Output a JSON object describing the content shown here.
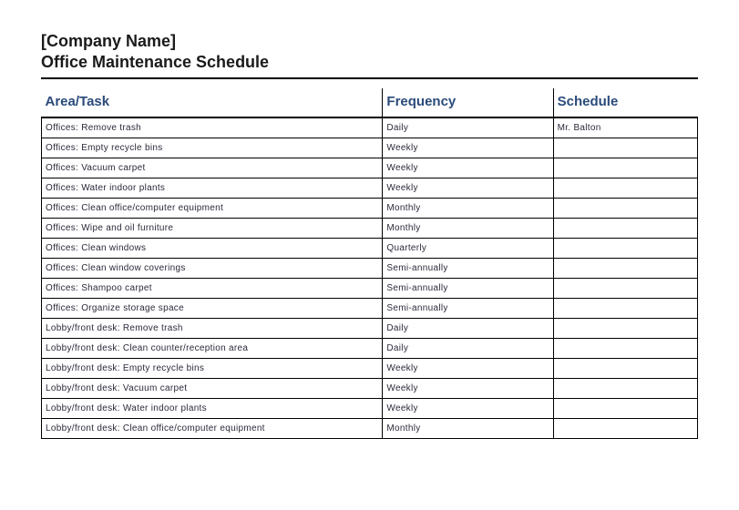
{
  "header": {
    "company_name": "[Company Name]",
    "doc_title": "Office Maintenance Schedule"
  },
  "table": {
    "columns": {
      "area": "Area/Task",
      "frequency": "Frequency",
      "schedule": "Schedule"
    },
    "rows": [
      {
        "area": "Offices: Remove trash",
        "frequency": "Daily",
        "schedule": "Mr. Balton"
      },
      {
        "area": "Offices: Empty recycle bins",
        "frequency": "Weekly",
        "schedule": ""
      },
      {
        "area": "Offices: Vacuum carpet",
        "frequency": "Weekly",
        "schedule": ""
      },
      {
        "area": "Offices: Water indoor plants",
        "frequency": "Weekly",
        "schedule": ""
      },
      {
        "area": "Offices: Clean office/computer equipment",
        "frequency": "Monthly",
        "schedule": ""
      },
      {
        "area": "Offices: Wipe and oil furniture",
        "frequency": "Monthly",
        "schedule": ""
      },
      {
        "area": "Offices: Clean windows",
        "frequency": "Quarterly",
        "schedule": ""
      },
      {
        "area": "Offices: Clean window coverings",
        "frequency": "Semi-annually",
        "schedule": ""
      },
      {
        "area": "Offices: Shampoo carpet",
        "frequency": "Semi-annually",
        "schedule": ""
      },
      {
        "area": "Offices: Organize storage space",
        "frequency": "Semi-annually",
        "schedule": ""
      },
      {
        "area": "Lobby/front desk: Remove trash",
        "frequency": "Daily",
        "schedule": ""
      },
      {
        "area": "Lobby/front desk: Clean counter/reception area",
        "frequency": "Daily",
        "schedule": ""
      },
      {
        "area": "Lobby/front desk: Empty recycle bins",
        "frequency": "Weekly",
        "schedule": ""
      },
      {
        "area": "Lobby/front desk: Vacuum carpet",
        "frequency": "Weekly",
        "schedule": ""
      },
      {
        "area": "Lobby/front desk: Water indoor plants",
        "frequency": "Weekly",
        "schedule": ""
      },
      {
        "area": "Lobby/front desk: Clean office/computer equipment",
        "frequency": "Monthly",
        "schedule": ""
      }
    ]
  }
}
